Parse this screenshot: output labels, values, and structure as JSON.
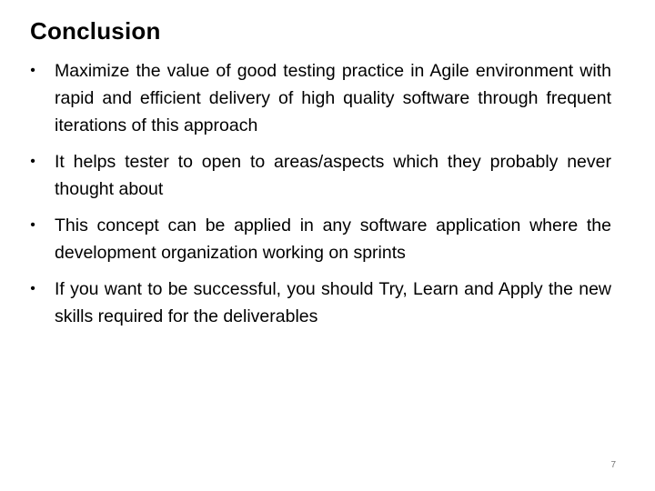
{
  "slide": {
    "title": "Conclusion",
    "bullet_marker": "•",
    "bullets": [
      {
        "text": "Maximize the value of good testing practice in Agile environment with rapid and efficient delivery of high quality software through frequent iterations of this approach"
      },
      {
        "text": "It helps tester to open to areas/aspects which they probably never thought about"
      },
      {
        "text": "This concept can be applied in any software application where the development organization working on sprints"
      },
      {
        "text": "If you want to be successful, you should Try, Learn and Apply the new skills required for the deliverables"
      }
    ],
    "page_number": "7"
  }
}
